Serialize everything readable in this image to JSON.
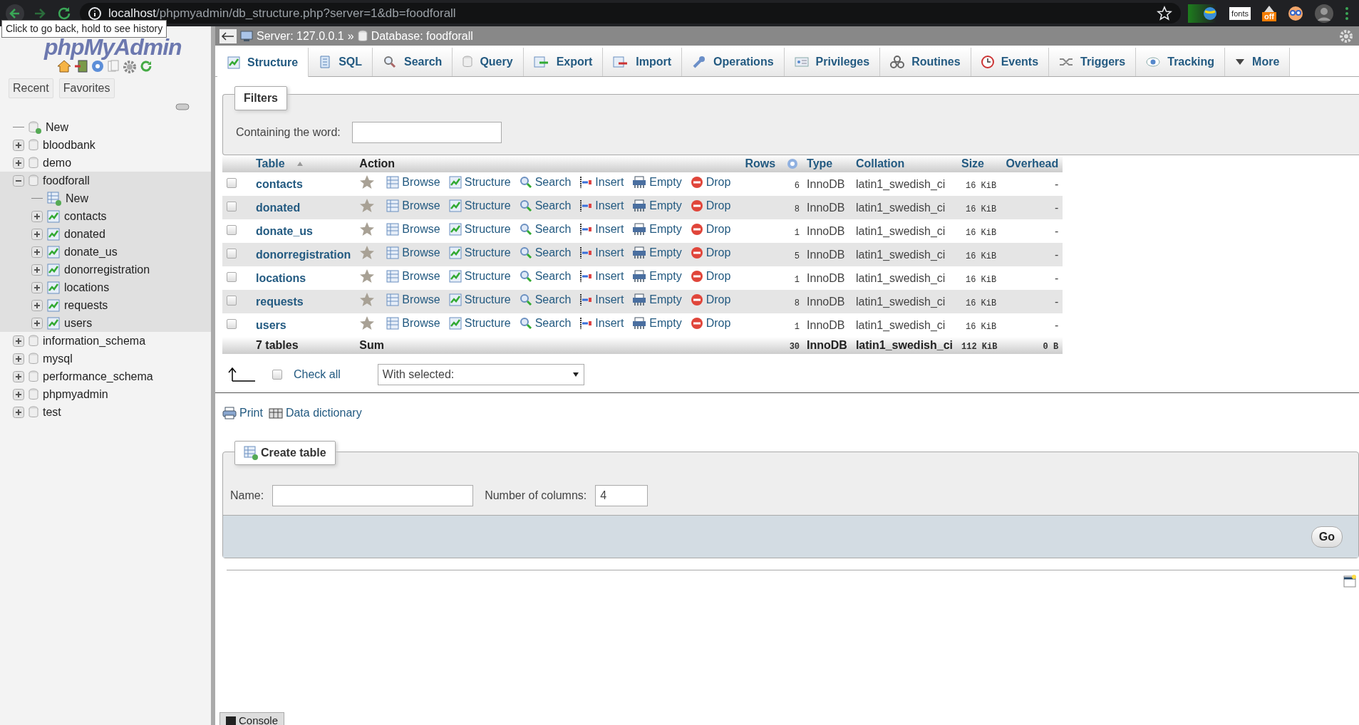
{
  "browser": {
    "url_host": "localhost",
    "url_path": "/phpmyadmin/db_structure.php?server=1&db=foodforall",
    "tooltip": "Click to go back, hold to see history",
    "extension_label": "fonts",
    "extension_badge": "off"
  },
  "sidebar": {
    "logo": "phpMyAdmin",
    "tabs": [
      {
        "label": "Recent"
      },
      {
        "label": "Favorites"
      }
    ],
    "tree": [
      {
        "label": "New",
        "kind": "new"
      },
      {
        "label": "bloodbank",
        "kind": "database",
        "expanded": false
      },
      {
        "label": "demo",
        "kind": "database",
        "expanded": false
      },
      {
        "label": "foodforall",
        "kind": "database",
        "expanded": true,
        "children": [
          {
            "label": "New",
            "kind": "new-table"
          },
          {
            "label": "contacts",
            "kind": "table",
            "expanded": false
          },
          {
            "label": "donated",
            "kind": "table",
            "expanded": false
          },
          {
            "label": "donate_us",
            "kind": "table",
            "expanded": false
          },
          {
            "label": "donorregistration",
            "kind": "table",
            "expanded": false
          },
          {
            "label": "locations",
            "kind": "table",
            "expanded": false
          },
          {
            "label": "requests",
            "kind": "table",
            "expanded": false
          },
          {
            "label": "users",
            "kind": "table",
            "expanded": false
          }
        ]
      },
      {
        "label": "information_schema",
        "kind": "database",
        "expanded": false
      },
      {
        "label": "mysql",
        "kind": "database",
        "expanded": false
      },
      {
        "label": "performance_schema",
        "kind": "database",
        "expanded": false
      },
      {
        "label": "phpmyadmin",
        "kind": "database",
        "expanded": false
      },
      {
        "label": "test",
        "kind": "database",
        "expanded": false
      }
    ]
  },
  "breadcrumb": {
    "server": "Server: 127.0.0.1",
    "separator": "»",
    "database": "Database: foodforall"
  },
  "tabs": [
    {
      "label": "Structure",
      "selected": true
    },
    {
      "label": "SQL",
      "selected": false
    },
    {
      "label": "Search",
      "selected": false
    },
    {
      "label": "Query",
      "selected": false
    },
    {
      "label": "Export",
      "selected": false
    },
    {
      "label": "Import",
      "selected": false
    },
    {
      "label": "Operations",
      "selected": false
    },
    {
      "label": "Privileges",
      "selected": false
    },
    {
      "label": "Routines",
      "selected": false
    },
    {
      "label": "Events",
      "selected": false
    },
    {
      "label": "Triggers",
      "selected": false
    },
    {
      "label": "Tracking",
      "selected": false
    },
    {
      "label": "More",
      "selected": false
    }
  ],
  "filters": {
    "legend": "Filters",
    "label": "Containing the word:"
  },
  "table": {
    "columns": [
      "Table",
      "Action",
      "Rows",
      "Type",
      "Collation",
      "Size",
      "Overhead"
    ],
    "rows": [
      {
        "checked": false,
        "name": "contacts",
        "actions": [
          "Browse",
          "Structure",
          "Search",
          "Insert",
          "Empty",
          "Drop"
        ],
        "rows": "6",
        "type": "InnoDB",
        "collation": "latin1_swedish_ci",
        "size": "16 KiB",
        "overhead": "-"
      },
      {
        "checked": false,
        "name": "donated",
        "actions": [
          "Browse",
          "Structure",
          "Search",
          "Insert",
          "Empty",
          "Drop"
        ],
        "rows": "8",
        "type": "InnoDB",
        "collation": "latin1_swedish_ci",
        "size": "16 KiB",
        "overhead": "-"
      },
      {
        "checked": false,
        "name": "donate_us",
        "actions": [
          "Browse",
          "Structure",
          "Search",
          "Insert",
          "Empty",
          "Drop"
        ],
        "rows": "1",
        "type": "InnoDB",
        "collation": "latin1_swedish_ci",
        "size": "16 KiB",
        "overhead": "-"
      },
      {
        "checked": false,
        "name": "donorregistration",
        "actions": [
          "Browse",
          "Structure",
          "Search",
          "Insert",
          "Empty",
          "Drop"
        ],
        "rows": "5",
        "type": "InnoDB",
        "collation": "latin1_swedish_ci",
        "size": "16 KiB",
        "overhead": "-"
      },
      {
        "checked": false,
        "name": "locations",
        "actions": [
          "Browse",
          "Structure",
          "Search",
          "Insert",
          "Empty",
          "Drop"
        ],
        "rows": "1",
        "type": "InnoDB",
        "collation": "latin1_swedish_ci",
        "size": "16 KiB",
        "overhead": "-"
      },
      {
        "checked": false,
        "name": "requests",
        "actions": [
          "Browse",
          "Structure",
          "Search",
          "Insert",
          "Empty",
          "Drop"
        ],
        "rows": "8",
        "type": "InnoDB",
        "collation": "latin1_swedish_ci",
        "size": "16 KiB",
        "overhead": "-"
      },
      {
        "checked": false,
        "name": "users",
        "actions": [
          "Browse",
          "Structure",
          "Search",
          "Insert",
          "Empty",
          "Drop"
        ],
        "rows": "1",
        "type": "InnoDB",
        "collation": "latin1_swedish_ci",
        "size": "16 KiB",
        "overhead": "-"
      }
    ],
    "footer": {
      "tables": "7 tables",
      "sum": "Sum",
      "rows": "30",
      "type": "InnoDB",
      "collation": "latin1_swedish_ci",
      "size": "112 KiB",
      "overhead": "0 B"
    }
  },
  "bulk": {
    "check_all": "Check all",
    "checked": false,
    "with_selected": "With selected:"
  },
  "links": [
    "Print",
    "Data dictionary"
  ],
  "create_table": {
    "legend": "Create table",
    "name_label": "Name:",
    "columns_label": "Number of columns:",
    "columns_value": "4",
    "go": "Go"
  },
  "console": "Console"
}
